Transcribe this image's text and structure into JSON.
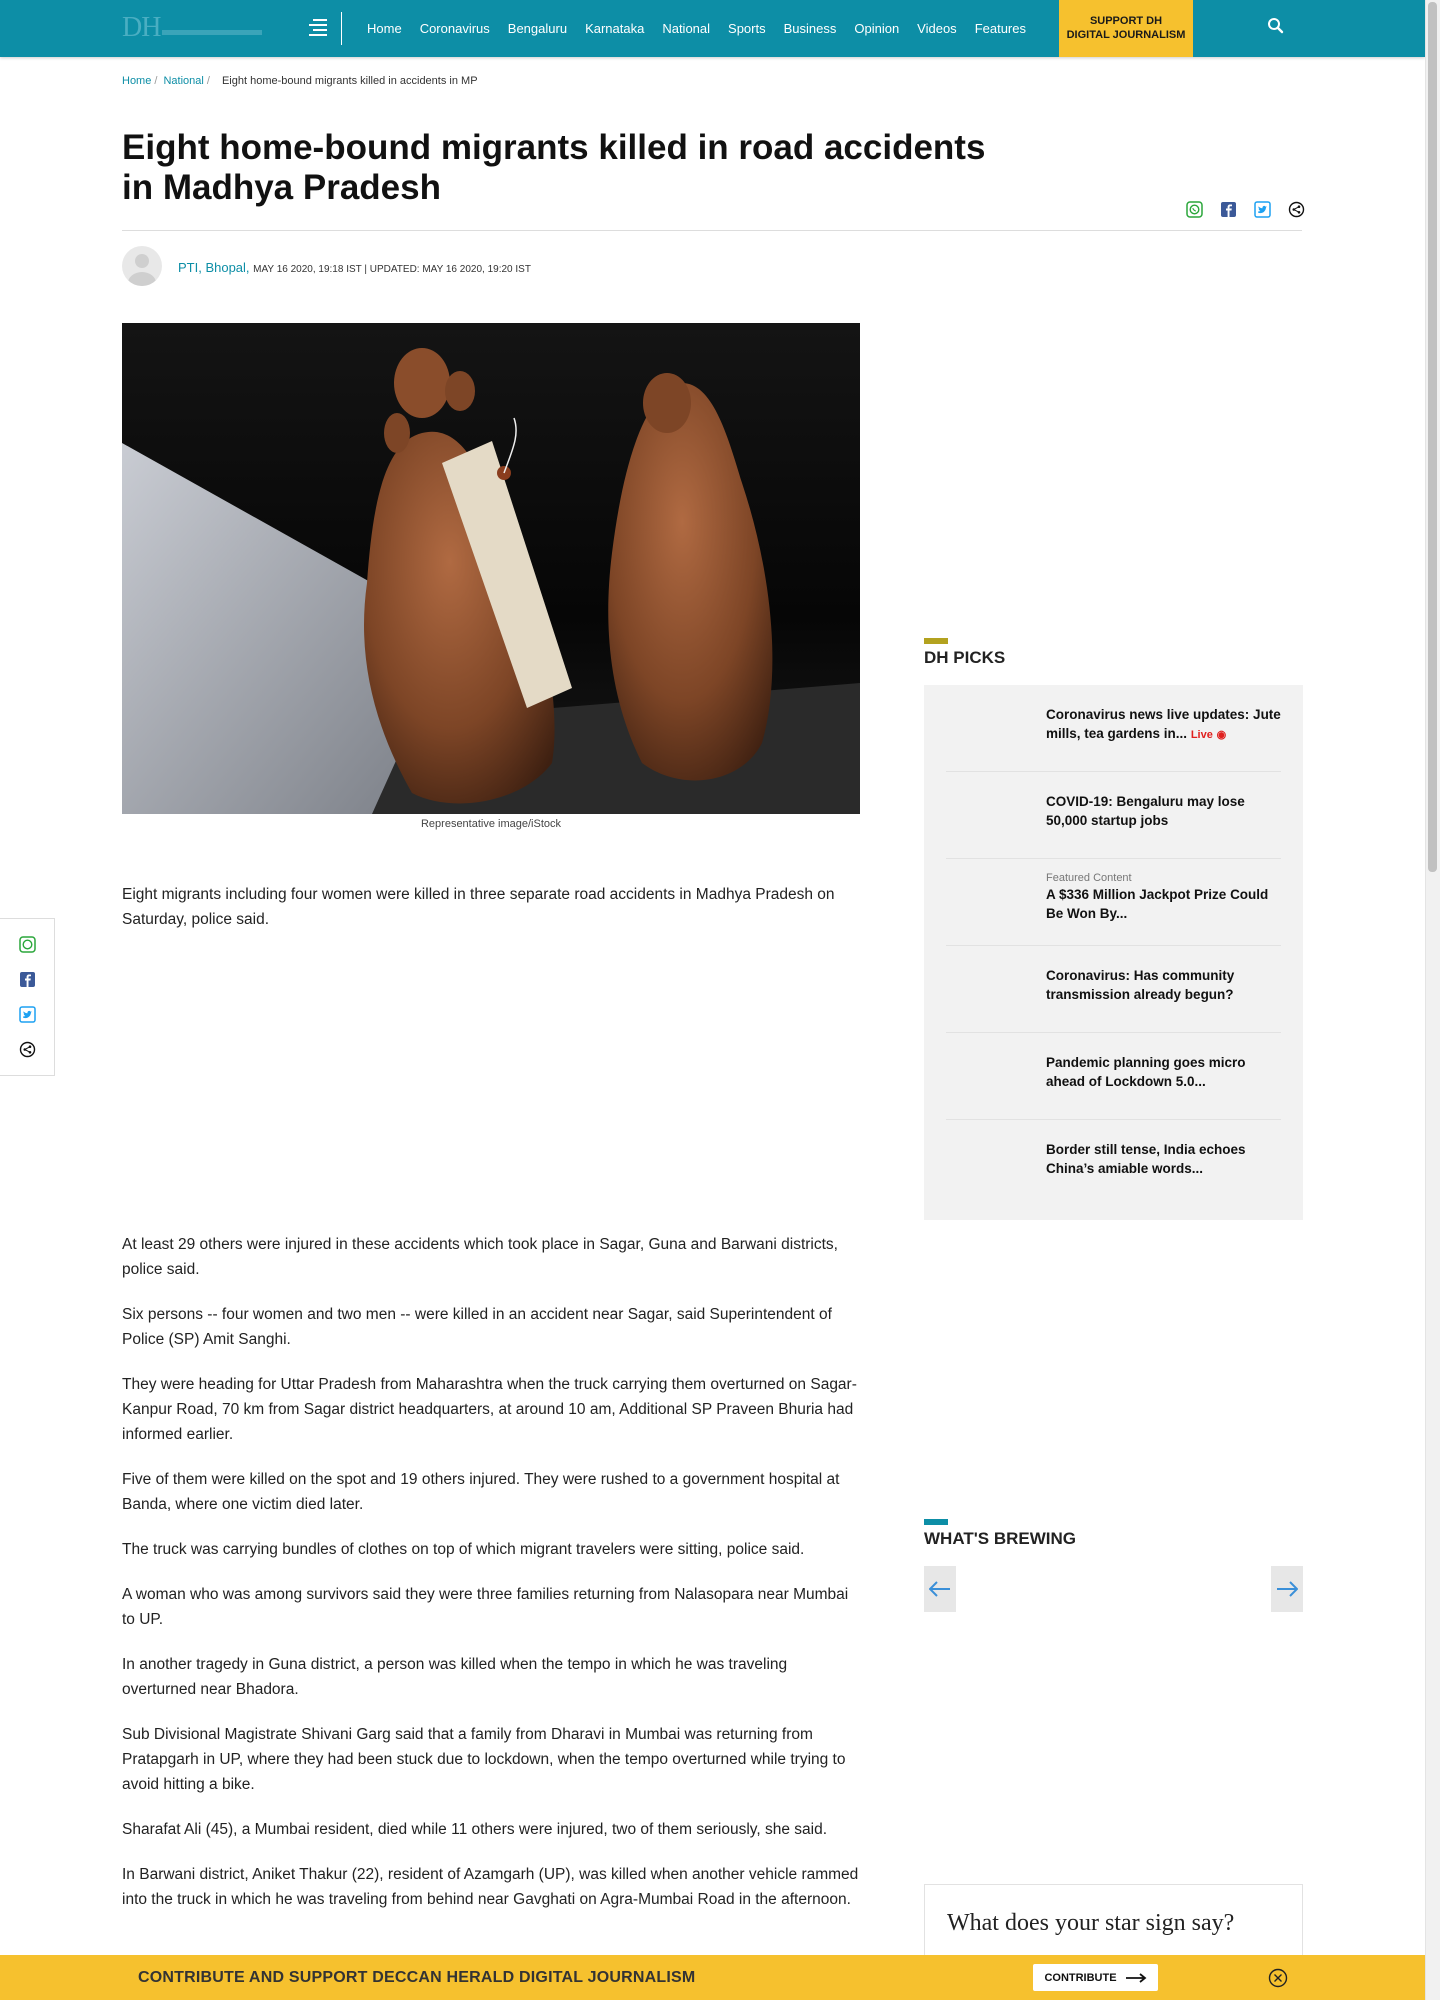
{
  "header": {
    "logo_text": "DH",
    "nav": [
      "Home",
      "Coronavirus",
      "Bengaluru",
      "Karnataka",
      "National",
      "Sports",
      "Business",
      "Opinion",
      "Videos",
      "Features"
    ],
    "support_line1": "SUPPORT DH",
    "support_line2": "DIGITAL JOURNALISM"
  },
  "breadcrumb": {
    "home": "Home",
    "section": "National",
    "current": "Eight home-bound migrants killed in accidents in MP"
  },
  "article": {
    "title": "Eight home-bound migrants killed in road accidents in Madhya Pradesh",
    "author": "PTI, Bhopal,",
    "published": "MAY 16 2020, 19:18 IST",
    "updated": "UPDATED: MAY 16 2020, 19:20 IST",
    "caption": "Representative image/iStock",
    "lead": "Eight migrants including four women were killed in three separate road accidents in Madhya Pradesh on Saturday, police said.",
    "paragraphs": [
      "At least 29 others were injured in these accidents which took place in Sagar, Guna and Barwani districts, police said.",
      "Six persons -- four women and two men -- were killed in an accident near Sagar, said Superintendent of Police (SP) Amit Sanghi.",
      "They were heading for Uttar Pradesh from Maharashtra when the truck carrying them overturned on Sagar-Kanpur Road, 70 km from Sagar district headquarters, at around 10 am, Additional SP Praveen Bhuria had informed earlier.",
      "Five of them were killed on the spot and 19 others injured. They were rushed to a government hospital at Banda, where one victim died later.",
      "The truck was carrying bundles of clothes on top of which migrant travelers were sitting, police said.",
      "A woman who was among survivors said they were three families returning from Nalasopara near Mumbai to UP.",
      "In another tragedy in Guna district, a person was killed when the tempo in which he was traveling overturned near Bhadora.",
      "Sub Divisional Magistrate Shivani Garg said that a family from Dharavi in Mumbai was returning from Pratapgarh in UP, where they had been stuck due to lockdown, when the tempo overturned while trying to avoid hitting a bike.",
      "Sharafat Ali (45), a Mumbai resident, died while 11 others were injured, two of them seriously, she said.",
      "In Barwani district, Aniket Thakur (22), resident of Azamgarh (UP), was killed when another vehicle rammed into the truck in which he was traveling from behind near Gavghati on Agra-Mumbai Road in the afternoon."
    ]
  },
  "sidebar": {
    "picks_title": "DH PICKS",
    "picks": [
      {
        "text": "Coronavirus news live updates: Jute mills, tea gardens in...",
        "live": "Live"
      },
      {
        "text": "COVID-19: Bengaluru may lose 50,000 startup jobs"
      },
      {
        "featured": "Featured Content",
        "text": "A $336 Million Jackpot Prize Could Be Won By..."
      },
      {
        "text": "Coronavirus: Has community transmission already begun?"
      },
      {
        "text": "Pandemic planning goes micro ahead of Lockdown 5.0..."
      },
      {
        "text": "Border still tense, India echoes China’s amiable words..."
      }
    ],
    "brewing_title": "WHAT'S BREWING",
    "star_text": "What does your star sign say?"
  },
  "banner": {
    "text": "CONTRIBUTE AND SUPPORT DECCAN HERALD DIGITAL JOURNALISM",
    "button": "CONTRIBUTE"
  },
  "colors": {
    "header_bg": "#0d8ea6",
    "support_bg": "#f6c12e",
    "picks_accent": "#b3a21f",
    "brewing_accent": "#0d8ea6",
    "live_red": "#e0201e"
  }
}
